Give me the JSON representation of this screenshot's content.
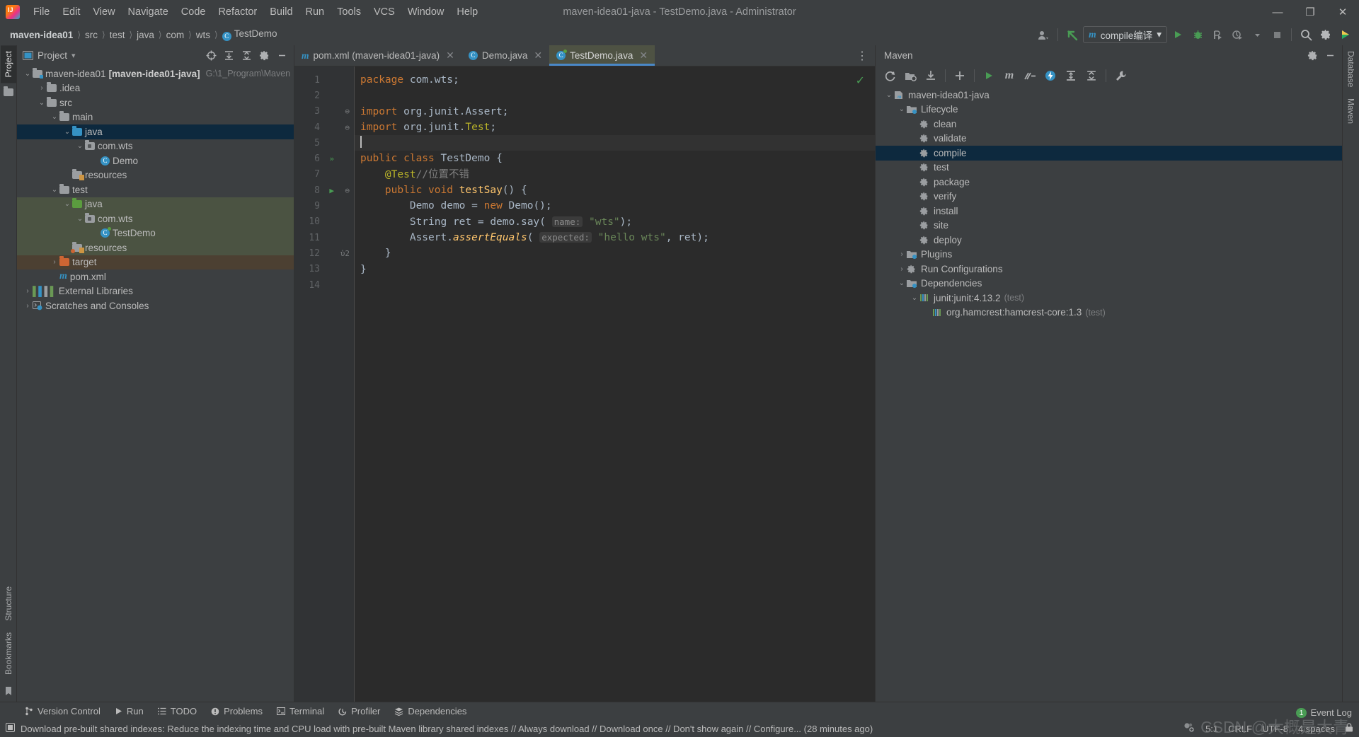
{
  "window": {
    "title": "maven-idea01-java - TestDemo.java - Administrator",
    "logo": "intellij-idea-logo",
    "minimize": "—",
    "maximize": "❐",
    "close": "✕"
  },
  "menu": {
    "items": [
      {
        "label": "File"
      },
      {
        "label": "Edit"
      },
      {
        "label": "View"
      },
      {
        "label": "Navigate"
      },
      {
        "label": "Code"
      },
      {
        "label": "Refactor"
      },
      {
        "label": "Build"
      },
      {
        "label": "Run"
      },
      {
        "label": "Tools"
      },
      {
        "label": "VCS"
      },
      {
        "label": "Window"
      },
      {
        "label": "Help"
      }
    ]
  },
  "breadcrumb": {
    "items": [
      {
        "label": "maven-idea01",
        "bold": true
      },
      {
        "label": "src"
      },
      {
        "label": "test"
      },
      {
        "label": "java"
      },
      {
        "label": "com"
      },
      {
        "label": "wts"
      },
      {
        "label": "TestDemo",
        "icon": "class-icon"
      }
    ],
    "separator": "〉"
  },
  "toolbar": {
    "account_icon": "account-icon",
    "update_icon": "update-project-icon",
    "run_config": {
      "label": "compile编译",
      "icon": "maven-m-icon",
      "chevron": "▾"
    },
    "run_icon": "run-icon",
    "debug_icon": "debug-icon",
    "run_coverage_icon": "run-with-coverage-icon",
    "profiler_icon": "profiler-icon",
    "stop_icon": "stop-icon",
    "search_icon": "search-everywhere-icon",
    "settings_icon": "settings-gear-icon",
    "ide_icon": "ide-feature-icon"
  },
  "left_stripe": {
    "top": [
      {
        "label": "Project",
        "icon": "project-folder-icon",
        "active": true
      }
    ],
    "bottom": [
      {
        "label": "Structure",
        "icon": "structure-icon"
      },
      {
        "label": "Bookmarks",
        "icon": "bookmarks-icon"
      }
    ]
  },
  "right_stripe": {
    "items": [
      {
        "label": "Database",
        "icon": "database-icon"
      },
      {
        "label": "Maven",
        "icon": "maven-icon"
      }
    ]
  },
  "project_panel": {
    "title": "Project",
    "chevron": "▾",
    "icon": "project-view-icon",
    "actions": [
      {
        "name": "select-opened-file-icon",
        "glyph": "⊕"
      },
      {
        "name": "expand-all-icon",
        "glyph": "≡"
      },
      {
        "name": "collapse-all-icon",
        "glyph": "≡"
      },
      {
        "name": "panel-settings-icon",
        "glyph": "⚙"
      },
      {
        "name": "hide-panel-icon",
        "glyph": "—"
      }
    ],
    "tree": [
      {
        "indent": 0,
        "chevron": "⌄",
        "icon": "module-folder-icon",
        "label": "maven-idea01",
        "bold_label": "[maven-idea01-java]",
        "dim": "G:\\1_Program\\Maven",
        "select": ""
      },
      {
        "indent": 1,
        "chevron": "›",
        "icon": "folder-icon",
        "label": ".idea",
        "select": ""
      },
      {
        "indent": 1,
        "chevron": "⌄",
        "icon": "folder-icon",
        "label": "src",
        "select": ""
      },
      {
        "indent": 2,
        "chevron": "⌄",
        "icon": "folder-icon",
        "label": "main",
        "select": ""
      },
      {
        "indent": 3,
        "chevron": "⌄",
        "icon": "source-folder-icon",
        "label": "java",
        "select": "blue"
      },
      {
        "indent": 4,
        "chevron": "⌄",
        "icon": "package-icon",
        "label": "com.wts",
        "select": ""
      },
      {
        "indent": 5,
        "chevron": "",
        "icon": "class-icon",
        "label": "Demo",
        "select": ""
      },
      {
        "indent": 3,
        "chevron": "",
        "icon": "resources-folder-icon",
        "label": "resources",
        "select": ""
      },
      {
        "indent": 2,
        "chevron": "⌄",
        "icon": "folder-icon",
        "label": "test",
        "select": ""
      },
      {
        "indent": 3,
        "chevron": "⌄",
        "icon": "test-source-folder-icon",
        "label": "java",
        "select": "green"
      },
      {
        "indent": 4,
        "chevron": "⌄",
        "icon": "package-icon",
        "label": "com.wts",
        "select": "green"
      },
      {
        "indent": 5,
        "chevron": "",
        "icon": "test-class-icon",
        "label": "TestDemo",
        "select": "green"
      },
      {
        "indent": 3,
        "chevron": "",
        "icon": "test-resources-folder-icon",
        "label": "resources",
        "select": "green"
      },
      {
        "indent": 2,
        "chevron": "›",
        "icon": "excluded-folder-icon",
        "label": "target",
        "select": "brown"
      },
      {
        "indent": 2,
        "chevron": "",
        "icon": "maven-pom-icon",
        "label": "pom.xml",
        "select": ""
      },
      {
        "indent": 0,
        "chevron": "›",
        "icon": "libraries-icon",
        "label": "External Libraries",
        "select": ""
      },
      {
        "indent": 0,
        "chevron": "›",
        "icon": "scratches-icon",
        "label": "Scratches and Consoles",
        "select": ""
      }
    ]
  },
  "editor": {
    "tabs": [
      {
        "label": "pom.xml (maven-idea01-java)",
        "icon": "maven-m-icon",
        "active": false,
        "close": "✕"
      },
      {
        "label": "Demo.java",
        "icon": "class-icon",
        "active": false,
        "close": "✕"
      },
      {
        "label": "TestDemo.java",
        "icon": "test-class-icon",
        "active": true,
        "close": "✕"
      }
    ],
    "more_icon": "tab-options-icon",
    "inspection_status": "✓",
    "lines": [
      {
        "num": "1",
        "run": "",
        "fold": "",
        "current": false,
        "tokens": [
          {
            "t": "package ",
            "c": "kw"
          },
          {
            "t": "com.wts;",
            "c": ""
          }
        ]
      },
      {
        "num": "2",
        "run": "",
        "fold": "",
        "current": false,
        "tokens": []
      },
      {
        "num": "3",
        "run": "",
        "fold": "⊖",
        "current": false,
        "tokens": [
          {
            "t": "import ",
            "c": "kw"
          },
          {
            "t": "org.junit.Assert;",
            "c": ""
          }
        ]
      },
      {
        "num": "4",
        "run": "",
        "fold": "⊖",
        "current": false,
        "tokens": [
          {
            "t": "import ",
            "c": "kw"
          },
          {
            "t": "org.junit.",
            "c": ""
          },
          {
            "t": "Test",
            "c": "ann"
          },
          {
            "t": ";",
            "c": ""
          }
        ]
      },
      {
        "num": "5",
        "run": "",
        "fold": "",
        "current": true,
        "tokens": [
          {
            "t": "",
            "c": "caret"
          }
        ]
      },
      {
        "num": "6",
        "run": "»",
        "fold": "",
        "current": false,
        "tokens": [
          {
            "t": "public class ",
            "c": "kw"
          },
          {
            "t": "TestDemo ",
            "c": ""
          },
          {
            "t": "{",
            "c": ""
          }
        ]
      },
      {
        "num": "7",
        "run": "",
        "fold": "",
        "current": false,
        "tokens": [
          {
            "t": "    ",
            "c": ""
          },
          {
            "t": "@Test",
            "c": "ann"
          },
          {
            "t": "//位置不错",
            "c": "cmt"
          }
        ]
      },
      {
        "num": "8",
        "run": "▶",
        "fold": "⊖",
        "current": false,
        "tokens": [
          {
            "t": "    ",
            "c": ""
          },
          {
            "t": "public void ",
            "c": "kw"
          },
          {
            "t": "testSay",
            "c": "fn"
          },
          {
            "t": "() {",
            "c": ""
          }
        ]
      },
      {
        "num": "9",
        "run": "",
        "fold": "",
        "current": false,
        "tokens": [
          {
            "t": "        Demo demo = ",
            "c": ""
          },
          {
            "t": "new ",
            "c": "kw"
          },
          {
            "t": "Demo();",
            "c": ""
          }
        ]
      },
      {
        "num": "10",
        "run": "",
        "fold": "",
        "current": false,
        "tokens": [
          {
            "t": "        String ret = demo.say( ",
            "c": ""
          },
          {
            "t": "name:",
            "c": "hint"
          },
          {
            "t": " ",
            "c": ""
          },
          {
            "t": "\"wts\"",
            "c": "str"
          },
          {
            "t": ");",
            "c": ""
          }
        ]
      },
      {
        "num": "11",
        "run": "",
        "fold": "",
        "current": false,
        "tokens": [
          {
            "t": "        Assert.",
            "c": ""
          },
          {
            "t": "assertEquals",
            "c": "fni"
          },
          {
            "t": "( ",
            "c": ""
          },
          {
            "t": "expected:",
            "c": "hint"
          },
          {
            "t": " ",
            "c": ""
          },
          {
            "t": "\"hello wts\"",
            "c": "str"
          },
          {
            "t": ", ret);",
            "c": ""
          }
        ]
      },
      {
        "num": "12",
        "run": "",
        "fold": "ὑ2",
        "current": false,
        "tokens": [
          {
            "t": "    }",
            "c": ""
          }
        ]
      },
      {
        "num": "13",
        "run": "",
        "fold": "",
        "current": false,
        "tokens": [
          {
            "t": "}",
            "c": ""
          }
        ]
      },
      {
        "num": "14",
        "run": "",
        "fold": "",
        "current": false,
        "tokens": []
      }
    ]
  },
  "maven_panel": {
    "title": "Maven",
    "actions": [
      {
        "name": "panel-settings-icon",
        "glyph": "⚙"
      },
      {
        "name": "hide-panel-icon",
        "glyph": "—"
      }
    ],
    "toolbar": [
      {
        "name": "reload-all-maven-projects-icon",
        "glyph": "↻"
      },
      {
        "name": "generate-sources-icon",
        "glyph": "὜1"
      },
      {
        "name": "download-sources-icon",
        "glyph": "⬇"
      },
      {
        "name": "add-maven-project-icon",
        "glyph": "＋"
      },
      {
        "name": "run-maven-build-icon",
        "glyph": "▶"
      },
      {
        "name": "execute-maven-goal-icon",
        "glyph": "m"
      },
      {
        "name": "toggle-skip-tests-icon",
        "glyph": "∤"
      },
      {
        "name": "toggle-offline-icon",
        "glyph": "⚡"
      },
      {
        "name": "show-dependencies-icon",
        "glyph": "⤓"
      },
      {
        "name": "collapse-all-icon",
        "glyph": "≡"
      },
      {
        "name": "maven-settings-icon",
        "glyph": "ὒ7"
      }
    ],
    "tree": [
      {
        "indent": 0,
        "chevron": "⌄",
        "icon": "maven-project-icon",
        "label": "maven-idea01-java",
        "suffix": "",
        "select": false
      },
      {
        "indent": 1,
        "chevron": "⌄",
        "icon": "lifecycle-folder-icon",
        "label": "Lifecycle",
        "suffix": "",
        "select": false
      },
      {
        "indent": 2,
        "chevron": "",
        "icon": "goal-gear-icon",
        "label": "clean",
        "suffix": "",
        "select": false
      },
      {
        "indent": 2,
        "chevron": "",
        "icon": "goal-gear-icon",
        "label": "validate",
        "suffix": "",
        "select": false
      },
      {
        "indent": 2,
        "chevron": "",
        "icon": "goal-gear-icon",
        "label": "compile",
        "suffix": "",
        "select": true
      },
      {
        "indent": 2,
        "chevron": "",
        "icon": "goal-gear-icon",
        "label": "test",
        "suffix": "",
        "select": false
      },
      {
        "indent": 2,
        "chevron": "",
        "icon": "goal-gear-icon",
        "label": "package",
        "suffix": "",
        "select": false
      },
      {
        "indent": 2,
        "chevron": "",
        "icon": "goal-gear-icon",
        "label": "verify",
        "suffix": "",
        "select": false
      },
      {
        "indent": 2,
        "chevron": "",
        "icon": "goal-gear-icon",
        "label": "install",
        "suffix": "",
        "select": false
      },
      {
        "indent": 2,
        "chevron": "",
        "icon": "goal-gear-icon",
        "label": "site",
        "suffix": "",
        "select": false
      },
      {
        "indent": 2,
        "chevron": "",
        "icon": "goal-gear-icon",
        "label": "deploy",
        "suffix": "",
        "select": false
      },
      {
        "indent": 1,
        "chevron": "›",
        "icon": "plugins-folder-icon",
        "label": "Plugins",
        "suffix": "",
        "select": false
      },
      {
        "indent": 1,
        "chevron": "›",
        "icon": "run-configurations-icon",
        "label": "Run Configurations",
        "suffix": "",
        "select": false
      },
      {
        "indent": 1,
        "chevron": "⌄",
        "icon": "dependencies-folder-icon",
        "label": "Dependencies",
        "suffix": "",
        "select": false
      },
      {
        "indent": 2,
        "chevron": "⌄",
        "icon": "library-icon",
        "label": "junit:junit:4.13.2",
        "suffix": "(test)",
        "select": false
      },
      {
        "indent": 3,
        "chevron": "",
        "icon": "library-icon",
        "label": "org.hamcrest:hamcrest-core:1.3",
        "suffix": "(test)",
        "select": false
      }
    ]
  },
  "bottom_strip": {
    "items": [
      {
        "label": "Version Control",
        "icon": "vcs-branch-icon"
      },
      {
        "label": "Run",
        "icon": "run-icon"
      },
      {
        "label": "TODO",
        "icon": "todo-icon"
      },
      {
        "label": "Problems",
        "icon": "problems-icon"
      },
      {
        "label": "Terminal",
        "icon": "terminal-icon"
      },
      {
        "label": "Profiler",
        "icon": "profiler-icon"
      },
      {
        "label": "Dependencies",
        "icon": "dependencies-icon"
      }
    ]
  },
  "statusbar": {
    "notification_icon": "notification-icon",
    "message": "Download pre-built shared indexes: Reduce the indexing time and CPU load with pre-built Maven library shared indexes // Always download // Download once // Don't show again // Configure... (28 minutes ago)",
    "inspections_icon": "inspections-widget-icon",
    "caret_position": "5:1",
    "line_separator": "CRLF",
    "encoding": "UTF-8",
    "indent": "4 spaces",
    "readonly_icon": "lock-toggle-icon",
    "event_log": {
      "label": "Event Log",
      "count": "1"
    },
    "watermark": "CSDN @大概是大青"
  }
}
